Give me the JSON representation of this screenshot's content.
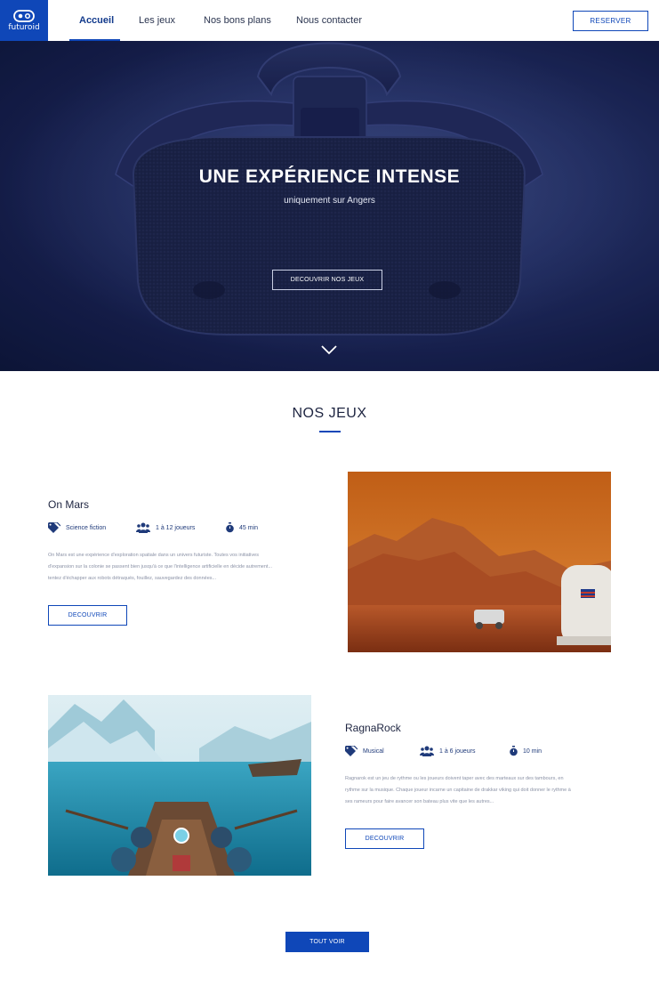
{
  "nav": {
    "logo_text": "futuroid",
    "links": [
      "Accueil",
      "Les jeux",
      "Nos bons plans",
      "Nous contacter"
    ],
    "reserve_label": "RESERVER"
  },
  "hero": {
    "title": "UNE EXPÉRIENCE INTENSE",
    "subtitle": "uniquement sur Angers",
    "button_label": "DECOUVRIR NOS JEUX"
  },
  "games_section": {
    "title": "NOS JEUX",
    "games": [
      {
        "name": "On Mars",
        "genre": "Science fiction",
        "players": "1 à 12 joueurs",
        "duration": "45 min",
        "description_lines": [
          "On Mars est une expérience d'exploration spatiale dans un univers futuriste. Toutes vos initiatives",
          "d'expansion sur la colonie se passent bien jusqu'à ce que l'intelligence artificielle en décide autrement...",
          "tentez d'échapper aux robots détraqués, fouillez, sauvegardez des données..."
        ],
        "button_label": "DECOUVRIR"
      },
      {
        "name": "RagnaRock",
        "genre": "Musical",
        "players": "1 à 6 joueurs",
        "duration": "10 min",
        "description_lines": [
          "Ragnarok est un jeu de rythme ou les joueurs doivent taper avec des marteaux sur des tambours, en",
          "rythme sur la musique. Chaque joueur incarne un capitaine de drakkar viking qui doit donner le rythme à",
          "ses rameurs pour faire avancer son bateau plus vite que les autres..."
        ],
        "button_label": "DECOUVRIR"
      }
    ],
    "all_button_label": "TOUT VOIR"
  },
  "colors": {
    "brand": "#0f47b8",
    "hero_dark": "#161f4c",
    "text_dark": "#1d2440"
  },
  "icons": [
    "vr-headset-logo-icon",
    "tag-icon",
    "users-icon",
    "stopwatch-icon",
    "chevron-down-icon"
  ]
}
